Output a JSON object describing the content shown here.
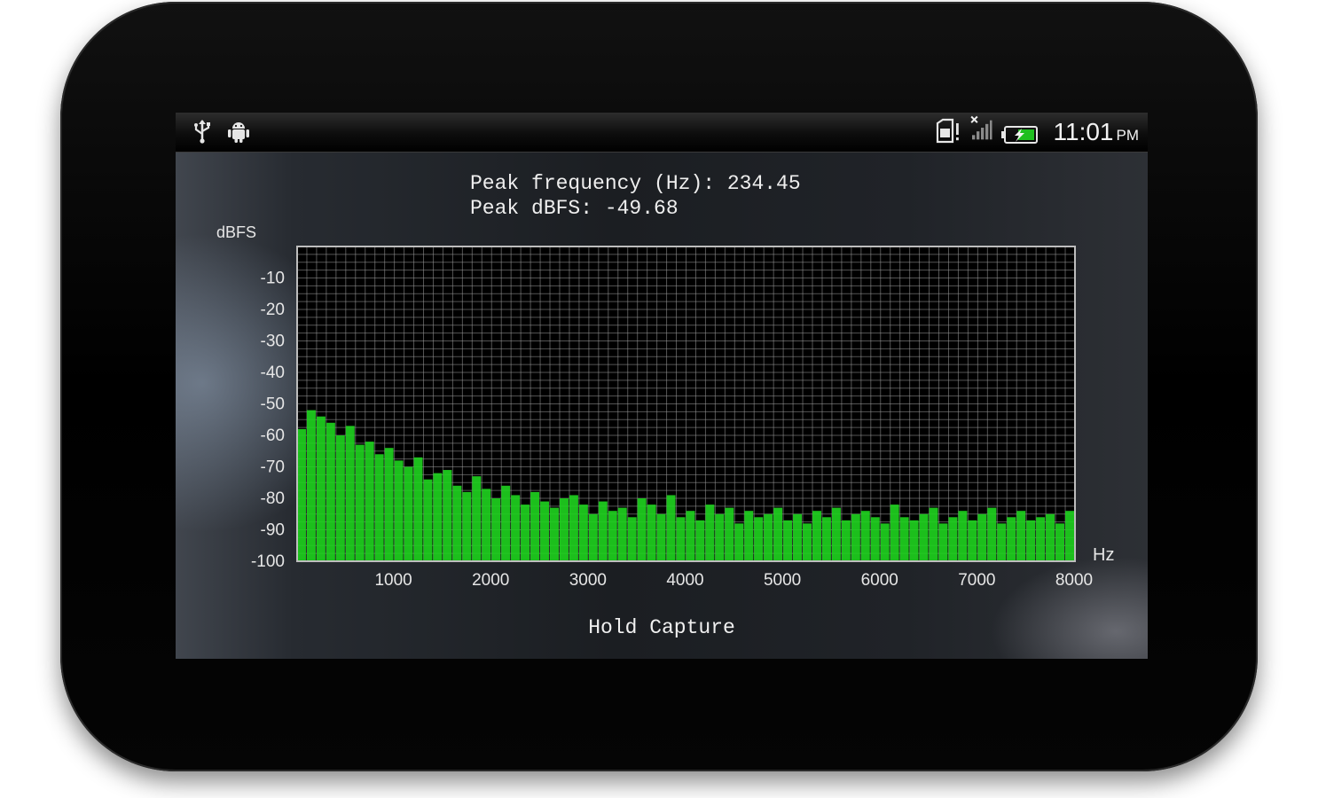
{
  "status_bar": {
    "left_icons": [
      "usb-icon",
      "debug-android-icon"
    ],
    "right_icons": [
      "sd-card-warning-icon",
      "no-signal-icon",
      "battery-charging-icon"
    ],
    "time": "11:01",
    "ampm": "PM"
  },
  "readout": {
    "peak_frequency": "Peak frequency (Hz): 234.45",
    "peak_dbfs": "Peak dBFS: -49.68"
  },
  "hold_capture_label": "Hold Capture",
  "colors": {
    "spectrum": "#1fd41f",
    "grid": "#9a9a9a",
    "plot_bg": "#000000"
  },
  "chart_data": {
    "type": "bar",
    "xlabel": "Hz",
    "ylabel": "dBFS",
    "xlim": [
      0,
      8000
    ],
    "ylim": [
      -100,
      0
    ],
    "x_ticks": [
      "1000",
      "2000",
      "3000",
      "4000",
      "5000",
      "6000",
      "7000",
      "8000"
    ],
    "y_ticks": [
      "-10",
      "-20",
      "-30",
      "-40",
      "-50",
      "-60",
      "-70",
      "-80",
      "-90",
      "-100"
    ],
    "grid": true,
    "bin_hz": 100,
    "series": [
      {
        "values": [
          -58,
          -52,
          -54,
          -56,
          -60,
          -57,
          -63,
          -62,
          -66,
          -64,
          -68,
          -70,
          -67,
          -74,
          -72,
          -71,
          -76,
          -78,
          -73,
          -77,
          -80,
          -76,
          -79,
          -82,
          -78,
          -81,
          -83,
          -80,
          -79,
          -82,
          -85,
          -81,
          -84,
          -83,
          -86,
          -80,
          -82,
          -85,
          -79,
          -86,
          -84,
          -87,
          -82,
          -85,
          -83,
          -88,
          -84,
          -86,
          -85,
          -83,
          -87,
          -85,
          -88,
          -84,
          -86,
          -83,
          -87,
          -85,
          -84,
          -86,
          -88,
          -82,
          -86,
          -87,
          -85,
          -83,
          -88,
          -86,
          -84,
          -87,
          -85,
          -83,
          -88,
          -86,
          -84,
          -87,
          -86,
          -85,
          -88,
          -84,
          -87
        ]
      }
    ]
  }
}
